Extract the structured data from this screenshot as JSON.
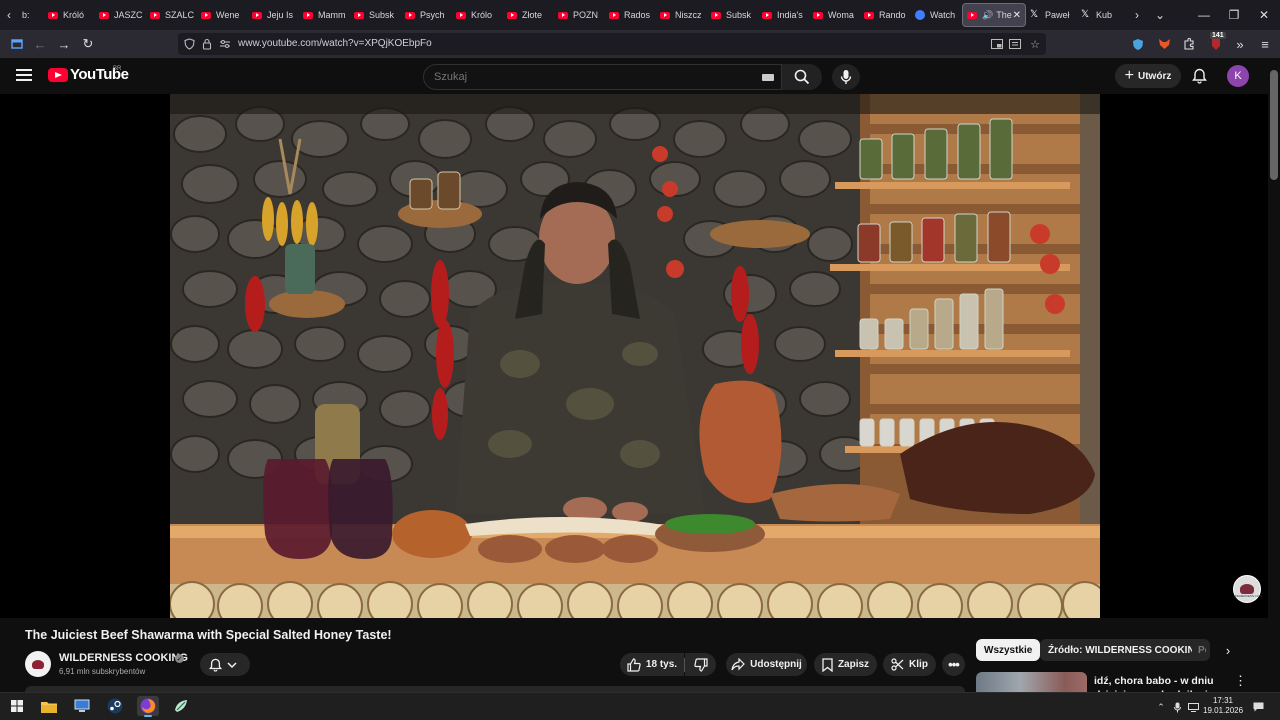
{
  "browser": {
    "tabs": [
      {
        "label": "Króló",
        "icon": "youtube-icon"
      },
      {
        "label": "JASZC",
        "icon": "youtube-icon"
      },
      {
        "label": "SZALC",
        "icon": "youtube-icon"
      },
      {
        "label": "Wene",
        "icon": "youtube-icon"
      },
      {
        "label": "Jeju Is",
        "icon": "youtube-icon"
      },
      {
        "label": "Mamm",
        "icon": "youtube-icon"
      },
      {
        "label": "Subsk",
        "icon": "youtube-icon"
      },
      {
        "label": "Psych",
        "icon": "youtube-icon"
      },
      {
        "label": "Królo",
        "icon": "youtube-icon"
      },
      {
        "label": "Złote",
        "icon": "youtube-icon"
      },
      {
        "label": "POZN",
        "icon": "youtube-icon"
      },
      {
        "label": "Rados",
        "icon": "youtube-icon"
      },
      {
        "label": "Niszcz",
        "icon": "youtube-icon"
      },
      {
        "label": "Subsk",
        "icon": "youtube-icon"
      },
      {
        "label": "India's",
        "icon": "youtube-icon"
      },
      {
        "label": "Woma",
        "icon": "youtube-icon"
      },
      {
        "label": "Rando",
        "icon": "youtube-icon"
      },
      {
        "label": "Watch",
        "icon": "watch-icon"
      },
      {
        "label": "The",
        "icon": "youtube-icon",
        "active": true
      },
      {
        "label": "Paweł",
        "icon": "x-icon"
      },
      {
        "label": "Kub",
        "icon": "x-icon"
      }
    ],
    "first_tab_label": "b:",
    "url": "www.youtube.com/watch?v=XPQjKOEbpFo",
    "extension_badge": "141"
  },
  "youtube": {
    "logo_text": "YouTube",
    "country_code": "BR",
    "search_placeholder": "Szukaj",
    "create_label": "Utwórz",
    "avatar_letter": "K",
    "accent": "#ff0033"
  },
  "video": {
    "title": "The Juiciest Beef Shawarma with Special Salted Honey Taste!",
    "watermark_text": "WILDERNESS COOKING"
  },
  "channel": {
    "name": "WILDERNESS COOKING",
    "subscribers": "6,91 mln subskrybentów"
  },
  "actions": {
    "likes": "18 tys.",
    "share": "Udostępnij",
    "save": "Zapisz",
    "clip": "Klip"
  },
  "sidebar": {
    "chips": [
      "Wszystkie",
      "Źródło: WILDERNESS COOKING",
      "Po"
    ],
    "recommendation_title": "idź, chora babo - w dniu dzisiejszym chodnik niesz.."
  },
  "taskbar": {
    "time": "17:31",
    "date": "19.01.2026"
  }
}
